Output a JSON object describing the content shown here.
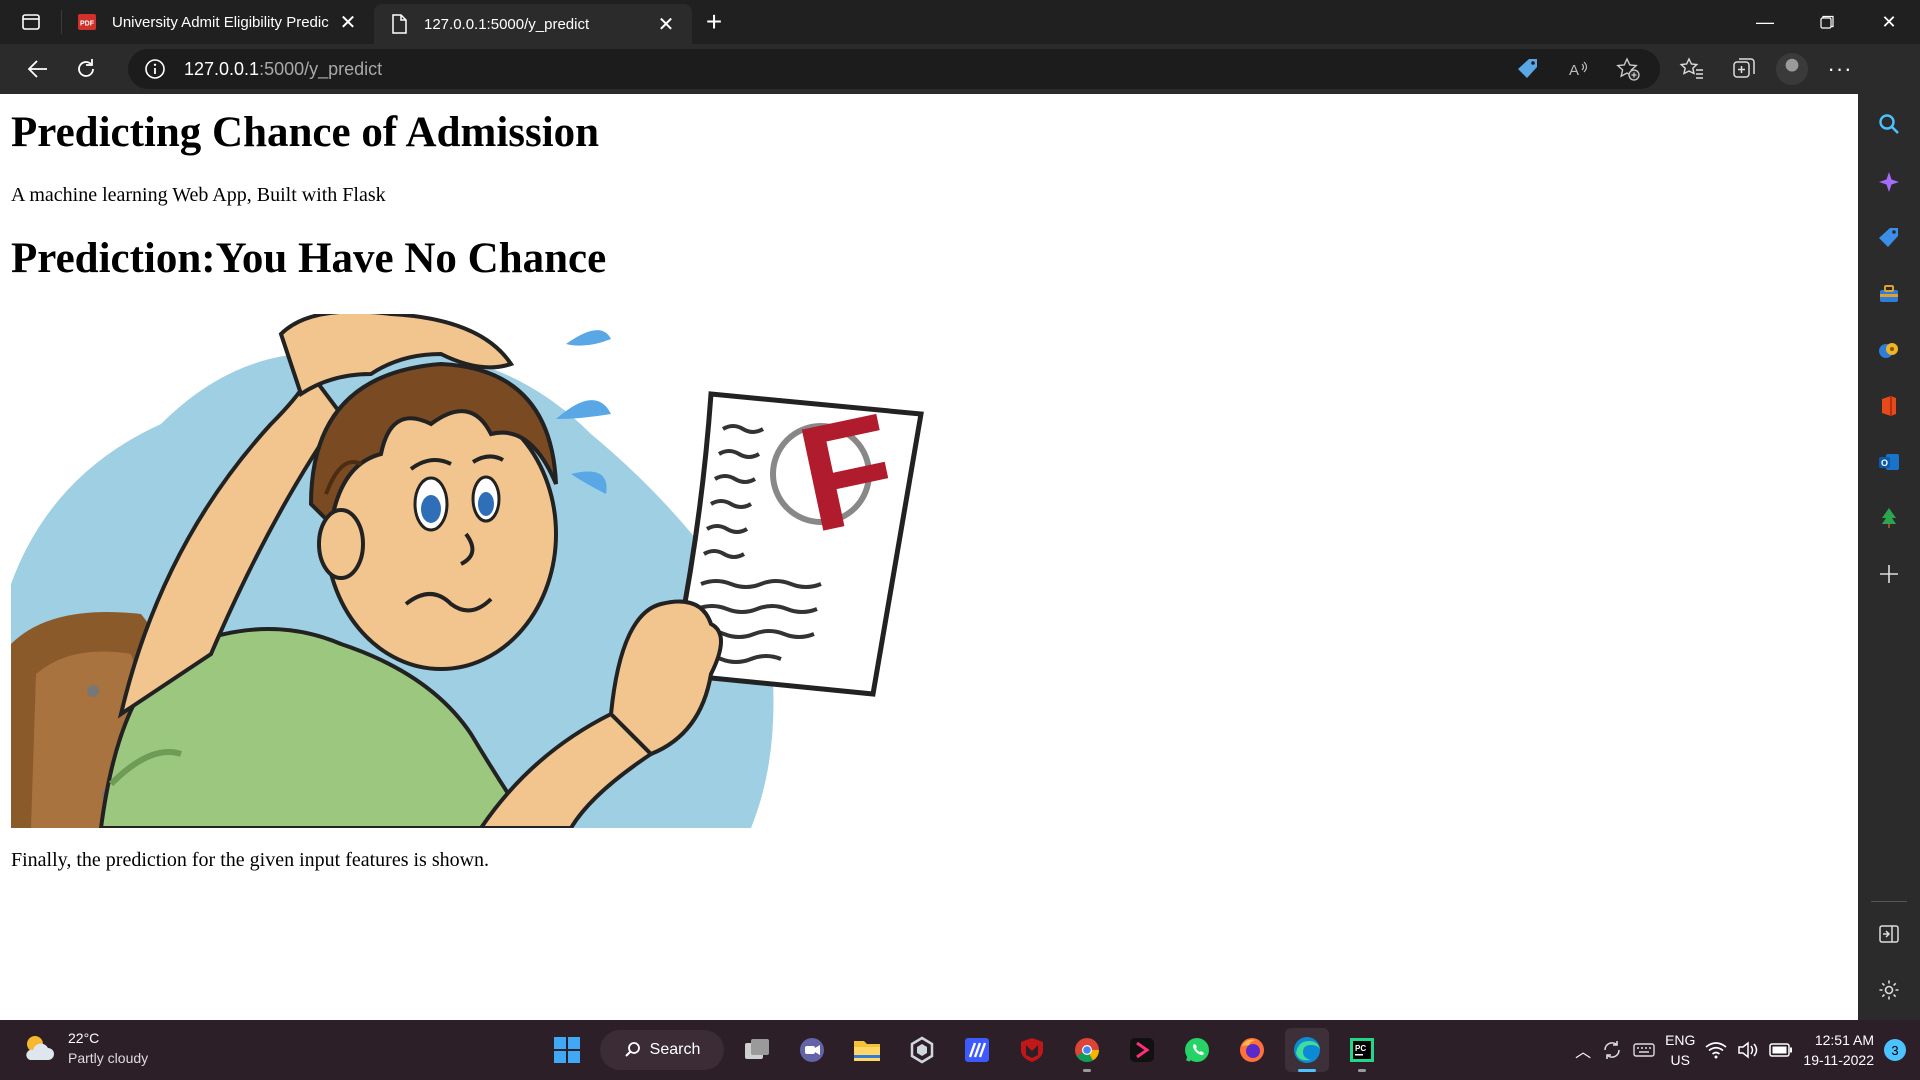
{
  "browser": {
    "tabs": [
      {
        "label": "University Admit Eligibility Predic",
        "icon": "pdf-icon",
        "active": false
      },
      {
        "label": "127.0.0.1:5000/y_predict",
        "icon": "page-icon",
        "active": true
      }
    ],
    "address": {
      "host": "127.0.0.1",
      "path": ":5000/y_predict"
    }
  },
  "page": {
    "title": "Predicting Chance of Admission",
    "subtitle": "A machine learning Web App, Built with Flask",
    "prediction": "Prediction:You Have No Chance",
    "image_grade": "F",
    "caption": "Finally, the prediction for the given input features is shown."
  },
  "taskbar": {
    "weather": {
      "temp": "22°C",
      "condition": "Partly cloudy"
    },
    "search_label": "Search",
    "language": {
      "line1": "ENG",
      "line2": "US"
    },
    "clock": {
      "time": "12:51 AM",
      "date": "19-11-2022"
    },
    "notifications": "3"
  },
  "colors": {
    "sky": "#9fcfe3",
    "shirt": "#9cc77e",
    "skin": "#f2c58f",
    "hair": "#7a4a22",
    "grade_red": "#b01c2e",
    "edge_blue": "#4cc2ff"
  }
}
